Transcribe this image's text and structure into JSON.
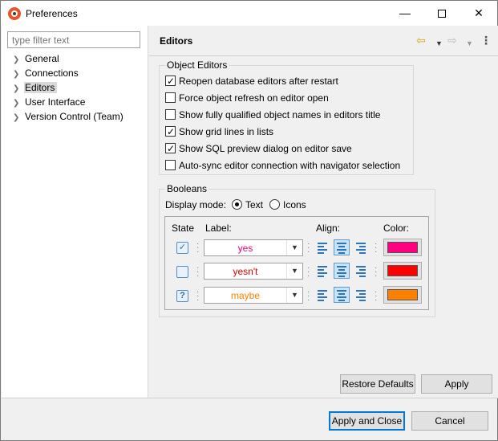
{
  "window": {
    "title": "Preferences",
    "minimize": "—",
    "close": "✕"
  },
  "sidebar": {
    "filter_placeholder": "type filter text",
    "items": [
      {
        "label": "General",
        "selected": false
      },
      {
        "label": "Connections",
        "selected": false
      },
      {
        "label": "Editors",
        "selected": true
      },
      {
        "label": "User Interface",
        "selected": false
      },
      {
        "label": "Version Control (Team)",
        "selected": false
      }
    ]
  },
  "page": {
    "title": "Editors",
    "nav": {
      "back": "⇦",
      "dropdown": "▼",
      "forward": "⇨",
      "more": "⋮"
    }
  },
  "object_editors": {
    "legend": "Object Editors",
    "options": [
      {
        "label": "Reopen database editors after restart",
        "checked": true
      },
      {
        "label": "Force object refresh on editor open",
        "checked": false
      },
      {
        "label": "Show fully qualified object names in editors title",
        "checked": false
      },
      {
        "label": "Show grid lines in lists",
        "checked": true
      },
      {
        "label": "Show SQL preview dialog on editor save",
        "checked": true
      },
      {
        "label": "Auto-sync editor connection with navigator selection",
        "checked": false
      }
    ]
  },
  "booleans": {
    "legend": "Booleans",
    "display_mode_label": "Display mode:",
    "modes": [
      {
        "label": "Text",
        "checked": true
      },
      {
        "label": "Icons",
        "checked": false
      }
    ],
    "headers": {
      "state": "State",
      "label": "Label:",
      "align": "Align:",
      "color": "Color:"
    },
    "rows": [
      {
        "state_icon": "check-state-icon",
        "state_glyph": "✓",
        "label": "yes",
        "text_color": "#e6007e",
        "align": "center",
        "color": "#ff0080"
      },
      {
        "state_icon": "empty-state-icon",
        "state_glyph": "",
        "label": "yesn't",
        "text_color": "#e00000",
        "align": "center",
        "color": "#ff0000"
      },
      {
        "state_icon": "question-state-icon",
        "state_glyph": "?",
        "label": "maybe",
        "text_color": "#ff8000",
        "align": "center",
        "color": "#ff8000"
      }
    ]
  },
  "buttons": {
    "restore_defaults": "Restore Defaults",
    "apply": "Apply",
    "apply_and_close": "Apply and Close",
    "cancel": "Cancel"
  }
}
